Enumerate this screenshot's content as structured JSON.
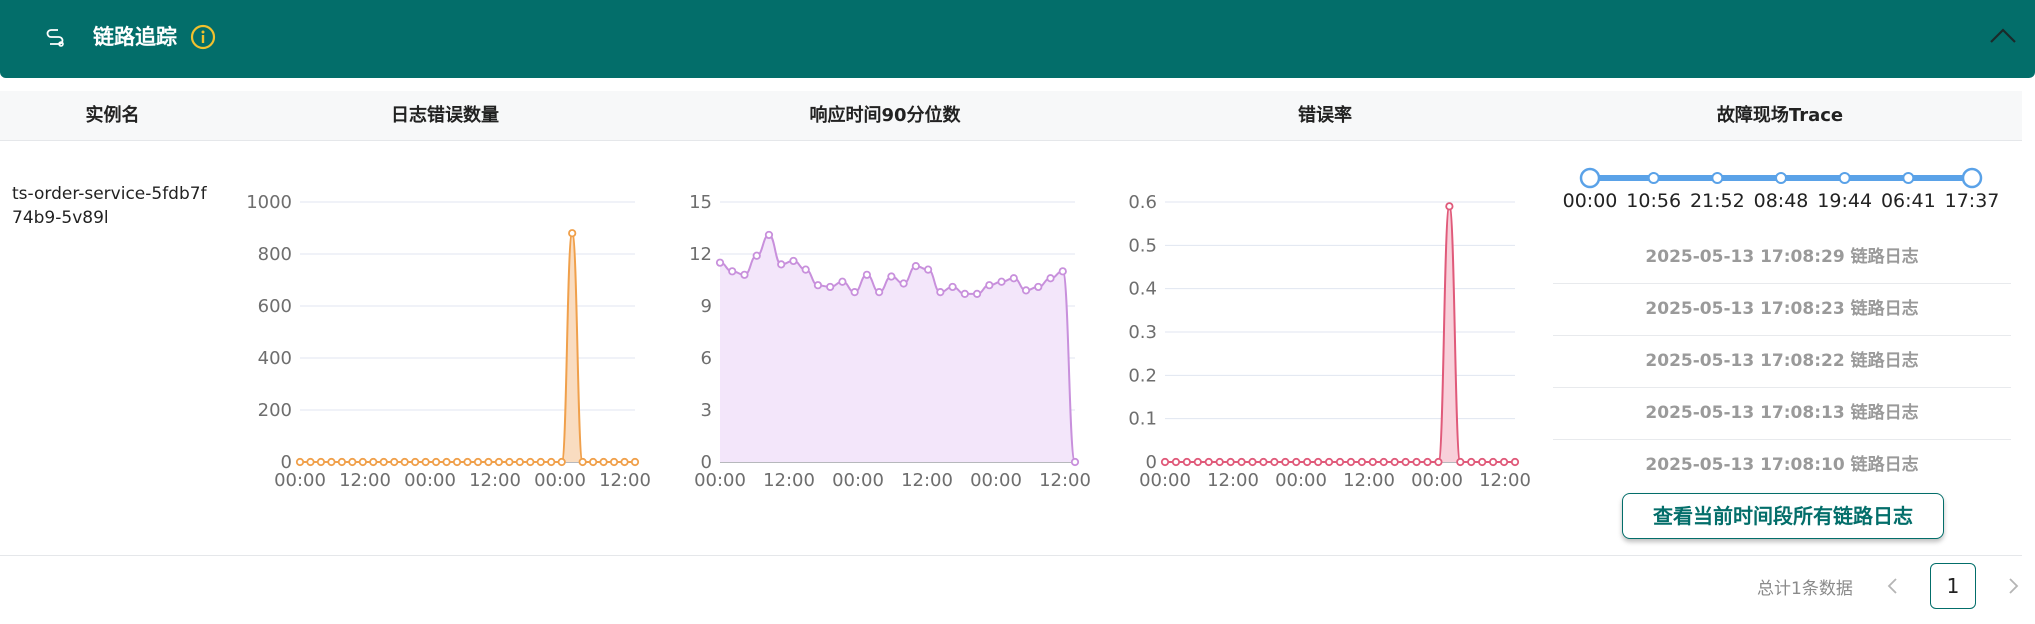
{
  "header": {
    "title": "链路追踪",
    "icons": {
      "route": "route-icon",
      "info": "info-icon",
      "collapse": "chevron-up-icon"
    },
    "colors": {
      "bar": "#036e6a",
      "info": "#f2c12e"
    }
  },
  "table": {
    "columns": [
      "实例名",
      "日志错误数量",
      "响应时间90分位数",
      "错误率",
      "故障现场Trace"
    ],
    "rows": [
      {
        "instance_name": "ts-order-service-5fdb7f74b9-5v89l"
      }
    ]
  },
  "chart_data": [
    {
      "name": "log-error-count",
      "type": "area",
      "color": "#f0a04b",
      "fill": "#f9dcc0",
      "x_tick_labels": [
        "00:00",
        "12:00",
        "00:00",
        "12:00",
        "00:00",
        "12:00"
      ],
      "ylim": [
        0,
        1000
      ],
      "y_ticks": [
        0,
        200,
        400,
        600,
        800,
        1000
      ],
      "y_tick_labels": [
        "0",
        "200",
        "400",
        "600",
        "800",
        "1000"
      ],
      "values": [
        0,
        0,
        0,
        0,
        0,
        0,
        0,
        0,
        0,
        0,
        0,
        0,
        0,
        0,
        0,
        0,
        0,
        0,
        0,
        0,
        0,
        0,
        0,
        0,
        0,
        0,
        880,
        0,
        0,
        0,
        0,
        0,
        0
      ],
      "grid": true
    },
    {
      "name": "response-time-p90",
      "type": "area",
      "color": "#c890dc",
      "fill": "#f3e6fa",
      "x_tick_labels": [
        "00:00",
        "12:00",
        "00:00",
        "12:00",
        "00:00",
        "12:00"
      ],
      "ylim": [
        0,
        15
      ],
      "y_ticks": [
        0,
        3,
        6,
        9,
        12,
        15
      ],
      "y_tick_labels": [
        "0",
        "3",
        "6",
        "9",
        "12",
        "15"
      ],
      "values": [
        11.5,
        11.0,
        10.8,
        11.9,
        13.1,
        11.4,
        11.6,
        11.1,
        10.2,
        10.1,
        10.4,
        9.8,
        10.8,
        9.8,
        10.7,
        10.3,
        11.3,
        11.1,
        9.8,
        10.1,
        9.7,
        9.7,
        10.2,
        10.4,
        10.6,
        9.9,
        10.1,
        10.6,
        11.0,
        0.0
      ],
      "grid": true
    },
    {
      "name": "error-rate",
      "type": "area",
      "color": "#e05a7a",
      "fill": "#f8d0da",
      "x_tick_labels": [
        "00:00",
        "12:00",
        "00:00",
        "12:00",
        "00:00",
        "12:00"
      ],
      "ylim": [
        0,
        0.6
      ],
      "y_ticks": [
        0,
        0.1,
        0.2,
        0.3,
        0.4,
        0.5,
        0.6
      ],
      "y_tick_labels": [
        "0",
        "0.1",
        "0.2",
        "0.3",
        "0.4",
        "0.5",
        "0.6"
      ],
      "values": [
        0,
        0,
        0,
        0,
        0,
        0,
        0,
        0,
        0,
        0,
        0,
        0,
        0,
        0,
        0,
        0,
        0,
        0,
        0,
        0,
        0,
        0,
        0,
        0,
        0,
        0,
        0.59,
        0,
        0,
        0,
        0,
        0,
        0
      ],
      "grid": true
    }
  ],
  "trace": {
    "timeline": [
      "00:00",
      "10:56",
      "21:52",
      "08:48",
      "19:44",
      "06:41",
      "17:37"
    ],
    "items": [
      {
        "label": "2025-05-13 17:08:29 链路日志"
      },
      {
        "label": "2025-05-13 17:08:23 链路日志"
      },
      {
        "label": "2025-05-13 17:08:22 链路日志"
      },
      {
        "label": "2025-05-13 17:08:13 链路日志"
      },
      {
        "label": "2025-05-13 17:08:10 链路日志"
      }
    ],
    "view_all_label": "查看当前时间段所有链路日志"
  },
  "pagination": {
    "total_label": "总计1条数据",
    "current_page": "1",
    "icons": {
      "prev": "chevron-left-icon",
      "next": "chevron-right-icon"
    }
  }
}
